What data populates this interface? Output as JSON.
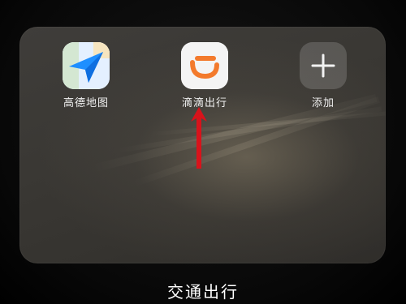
{
  "folder": {
    "title": "交通出行",
    "apps": [
      {
        "label": "高德地图",
        "icon": "amap-icon"
      },
      {
        "label": "滴滴出行",
        "icon": "didi-icon"
      },
      {
        "label": "添加",
        "icon": "plus-icon"
      }
    ]
  },
  "colors": {
    "arrow": "#d8131b",
    "didi_orange": "#f37a2c",
    "amap_blue": "#1e8fff"
  }
}
